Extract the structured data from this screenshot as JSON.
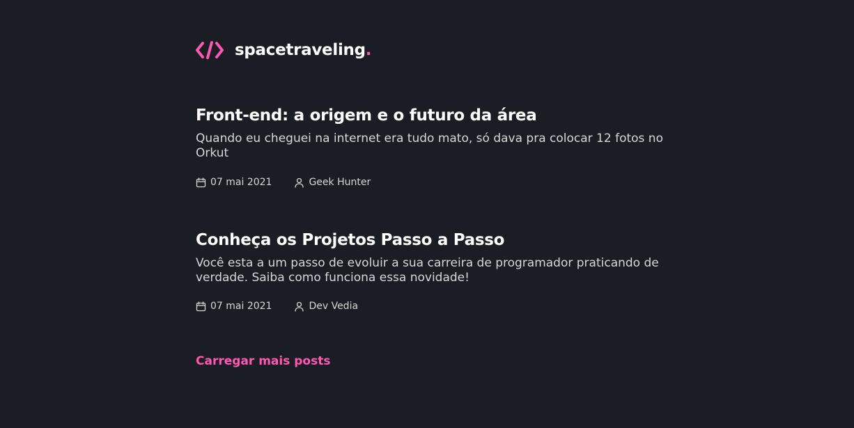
{
  "header": {
    "logo_name": "spacetraveling",
    "logo_dot": ".",
    "logo_icon": "code-brackets-icon"
  },
  "posts": [
    {
      "title": "Front-end: a origem e o futuro da área",
      "subtitle": "Quando eu cheguei na internet era tudo mato, só dava pra colocar 12 fotos no Orkut",
      "date": "07 mai 2021",
      "author": "Geek Hunter"
    },
    {
      "title": "Conheça os Projetos Passo a Passo",
      "subtitle": "Você esta a um passo de evoluir a sua carreira de programador praticando de verdade. Saiba como funciona essa novidade!",
      "date": "07 mai 2021",
      "author": "Dev Vedia"
    }
  ],
  "load_more_label": "Carregar mais posts",
  "colors": {
    "background": "#1a1d23",
    "accent": "#ff57b2",
    "text": "#ffffff",
    "muted": "#d7d7d7"
  }
}
